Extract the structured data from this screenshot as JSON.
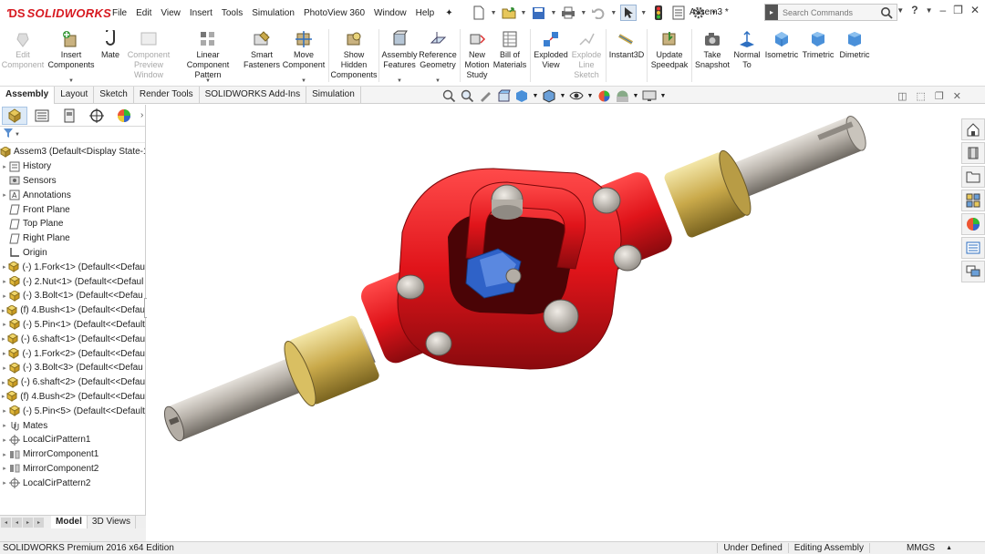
{
  "app": {
    "logo_text": "SOLIDWORKS",
    "menu": [
      "File",
      "Edit",
      "View",
      "Insert",
      "Tools",
      "Simulation",
      "PhotoView 360",
      "Window",
      "Help"
    ],
    "doc_title": "Assem3 *",
    "search_placeholder": "Search Commands"
  },
  "ribbon": {
    "buttons": [
      {
        "label": "Edit\nComponent",
        "icon": "edit-component-icon",
        "disabled": true
      },
      {
        "label": "Insert\nComponents",
        "icon": "insert-components-icon",
        "disabled": false
      },
      {
        "label": "Mate",
        "icon": "mate-icon",
        "disabled": false
      },
      {
        "label": "Component\nPreview\nWindow",
        "icon": "component-preview-icon",
        "disabled": true
      },
      {
        "label": "Linear Component\nPattern",
        "icon": "linear-pattern-icon",
        "disabled": false
      },
      {
        "label": "Smart\nFasteners",
        "icon": "smart-fasteners-icon",
        "disabled": false
      },
      {
        "label": "Move\nComponent",
        "icon": "move-component-icon",
        "disabled": false
      },
      {
        "label": "Show\nHidden\nComponents",
        "icon": "show-hidden-icon",
        "disabled": false
      },
      {
        "label": "Assembly\nFeatures",
        "icon": "assembly-features-icon",
        "disabled": false
      },
      {
        "label": "Reference\nGeometry",
        "icon": "reference-geometry-icon",
        "disabled": false
      },
      {
        "label": "New\nMotion\nStudy",
        "icon": "motion-study-icon",
        "disabled": false
      },
      {
        "label": "Bill of\nMaterials",
        "icon": "bill-of-materials-icon",
        "disabled": false
      },
      {
        "label": "Exploded\nView",
        "icon": "exploded-view-icon",
        "disabled": false
      },
      {
        "label": "Explode\nLine\nSketch",
        "icon": "explode-line-icon",
        "disabled": true
      },
      {
        "label": "Instant3D",
        "icon": "instant3d-icon",
        "disabled": false
      },
      {
        "label": "Update\nSpeedpak",
        "icon": "speedpak-icon",
        "disabled": false
      },
      {
        "label": "Take\nSnapshot",
        "icon": "snapshot-icon",
        "disabled": false
      },
      {
        "label": "Normal\nTo",
        "icon": "normal-to-icon",
        "disabled": false
      },
      {
        "label": "Isometric",
        "icon": "isometric-icon",
        "disabled": false
      },
      {
        "label": "Trimetric",
        "icon": "trimetric-icon",
        "disabled": false
      },
      {
        "label": "Dimetric",
        "icon": "dimetric-icon",
        "disabled": false
      }
    ]
  },
  "command_tabs": [
    "Assembly",
    "Layout",
    "Sketch",
    "Render Tools",
    "SOLIDWORKS Add-Ins",
    "Simulation"
  ],
  "tree": [
    {
      "label": "Assem3  (Default<Display State-1",
      "icon": "assembly-icon",
      "expand": false,
      "root": true
    },
    {
      "label": "History",
      "icon": "history-icon",
      "expand": true
    },
    {
      "label": "Sensors",
      "icon": "sensors-icon",
      "expand": false
    },
    {
      "label": "Annotations",
      "icon": "annotations-icon",
      "expand": true
    },
    {
      "label": "Front Plane",
      "icon": "plane-icon",
      "expand": false
    },
    {
      "label": "Top Plane",
      "icon": "plane-icon",
      "expand": false
    },
    {
      "label": "Right Plane",
      "icon": "plane-icon",
      "expand": false
    },
    {
      "label": "Origin",
      "icon": "origin-icon",
      "expand": false
    },
    {
      "label": "(-) 1.Fork<1>  (Default<<Defau",
      "icon": "part-icon",
      "expand": true
    },
    {
      "label": "(-) 2.Nut<1>  (Default<<Defaul",
      "icon": "part-icon",
      "expand": true
    },
    {
      "label": "(-) 3.Bolt<1>  (Default<<Defau",
      "icon": "part-icon",
      "expand": true
    },
    {
      "label": "(f) 4.Bush<1>  (Default<<Defau",
      "icon": "part-icon",
      "expand": true
    },
    {
      "label": "(-) 5.Pin<1>  (Default<<Default",
      "icon": "part-icon",
      "expand": true
    },
    {
      "label": "(-) 6.shaft<1>  (Default<<Defau",
      "icon": "part-icon",
      "expand": true
    },
    {
      "label": "(-) 1.Fork<2>  (Default<<Defau",
      "icon": "part-icon",
      "expand": true
    },
    {
      "label": "(-) 3.Bolt<3>  (Default<<Defau",
      "icon": "part-icon",
      "expand": true
    },
    {
      "label": "(-) 6.shaft<2>  (Default<<Defau",
      "icon": "part-icon",
      "expand": true
    },
    {
      "label": "(f) 4.Bush<2>  (Default<<Defau",
      "icon": "part-icon",
      "expand": true
    },
    {
      "label": "(-) 5.Pin<5>  (Default<<Default",
      "icon": "part-icon",
      "expand": true
    },
    {
      "label": "Mates",
      "icon": "mates-icon",
      "expand": true
    },
    {
      "label": "LocalCirPattern1",
      "icon": "pattern-icon",
      "expand": true
    },
    {
      "label": "MirrorComponent1",
      "icon": "mirror-icon",
      "expand": true
    },
    {
      "label": "MirrorComponent2",
      "icon": "mirror-icon",
      "expand": true
    },
    {
      "label": "LocalCirPattern2",
      "icon": "pattern-icon",
      "expand": true
    }
  ],
  "bottom_tabs": [
    "Model",
    "3D Views"
  ],
  "status": {
    "left": "SOLIDWORKS Premium 2016 x64 Edition",
    "definition": "Under Defined",
    "mode": "Editing Assembly",
    "units": "MMGS"
  },
  "colors": {
    "fork": "#e0141a",
    "bush": "#c9a94a",
    "shaft": "#a9a39b",
    "spider": "#2f62c8"
  }
}
